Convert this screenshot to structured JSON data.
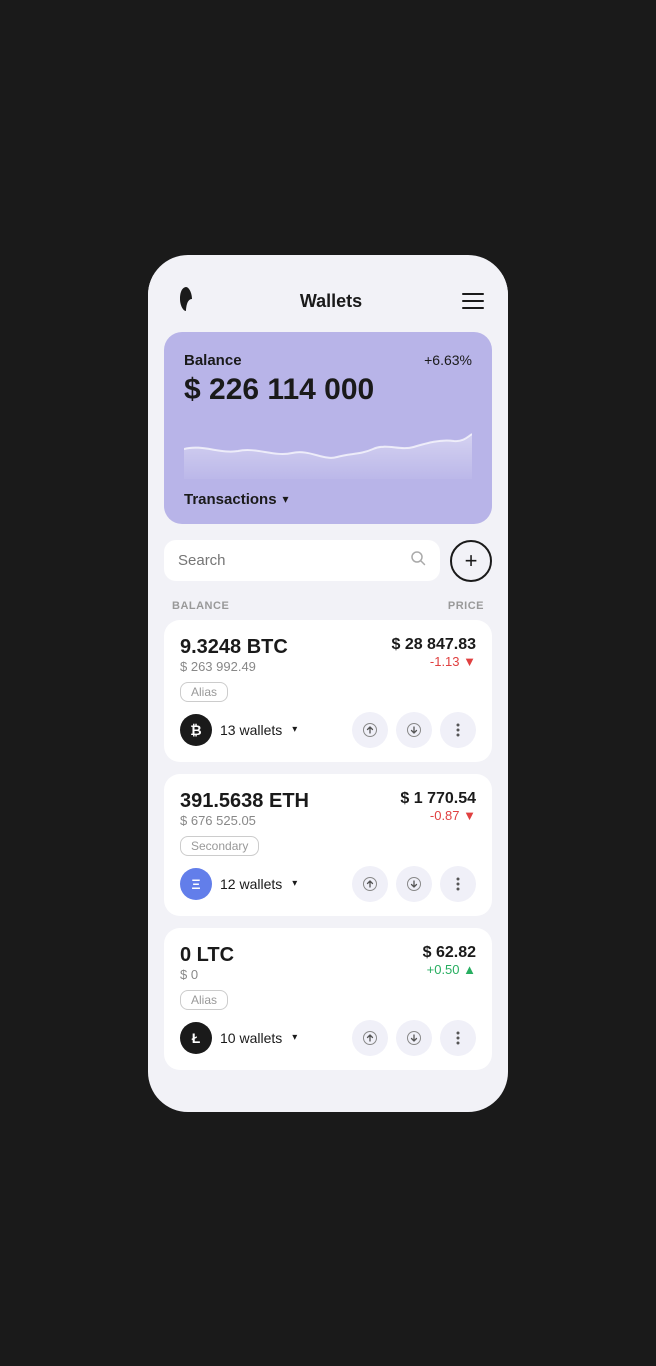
{
  "app": {
    "title": "Wallets"
  },
  "header": {
    "title": "Wallets",
    "menu_label": "Menu"
  },
  "balance_card": {
    "label": "Balance",
    "change": "+6.63%",
    "amount": "$ 226 114 000",
    "transactions_label": "Transactions"
  },
  "search": {
    "placeholder": "Search",
    "add_label": "+"
  },
  "columns": {
    "balance": "BALANCE",
    "price": "PRICE"
  },
  "coins": [
    {
      "amount": "9.3248 BTC",
      "usd_value": "$ 263 992.49",
      "tag": "Alias",
      "wallets": "13 wallets",
      "price": "$ 28 847.83",
      "change": "-1.13",
      "change_type": "negative",
      "icon_type": "btc",
      "icon_symbol": "₿"
    },
    {
      "amount": "391.5638 ETH",
      "usd_value": "$ 676 525.05",
      "tag": "Secondary",
      "wallets": "12 wallets",
      "price": "$ 1 770.54",
      "change": "-0.87",
      "change_type": "negative",
      "icon_type": "eth",
      "icon_symbol": "Ξ"
    },
    {
      "amount": "0 LTC",
      "usd_value": "$ 0",
      "tag": "Alias",
      "wallets": "10 wallets",
      "price": "$ 62.82",
      "change": "+0.50",
      "change_type": "positive",
      "icon_type": "ltc",
      "icon_symbol": "Ł"
    }
  ]
}
